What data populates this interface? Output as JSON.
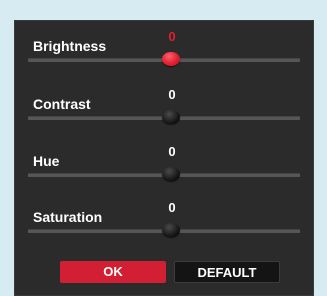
{
  "colors": {
    "page_background": "#d6ebf2",
    "panel_background": "#2b2b2b",
    "accent": "#d21f33",
    "active_value": "#e0202f",
    "text": "#ffffff"
  },
  "sliders": [
    {
      "label": "Brightness",
      "value": "0",
      "active": true
    },
    {
      "label": "Contrast",
      "value": "0",
      "active": false
    },
    {
      "label": "Hue",
      "value": "0",
      "active": false
    },
    {
      "label": "Saturation",
      "value": "0",
      "active": false
    }
  ],
  "buttons": {
    "ok_label": "OK",
    "default_label": "DEFAULT"
  }
}
